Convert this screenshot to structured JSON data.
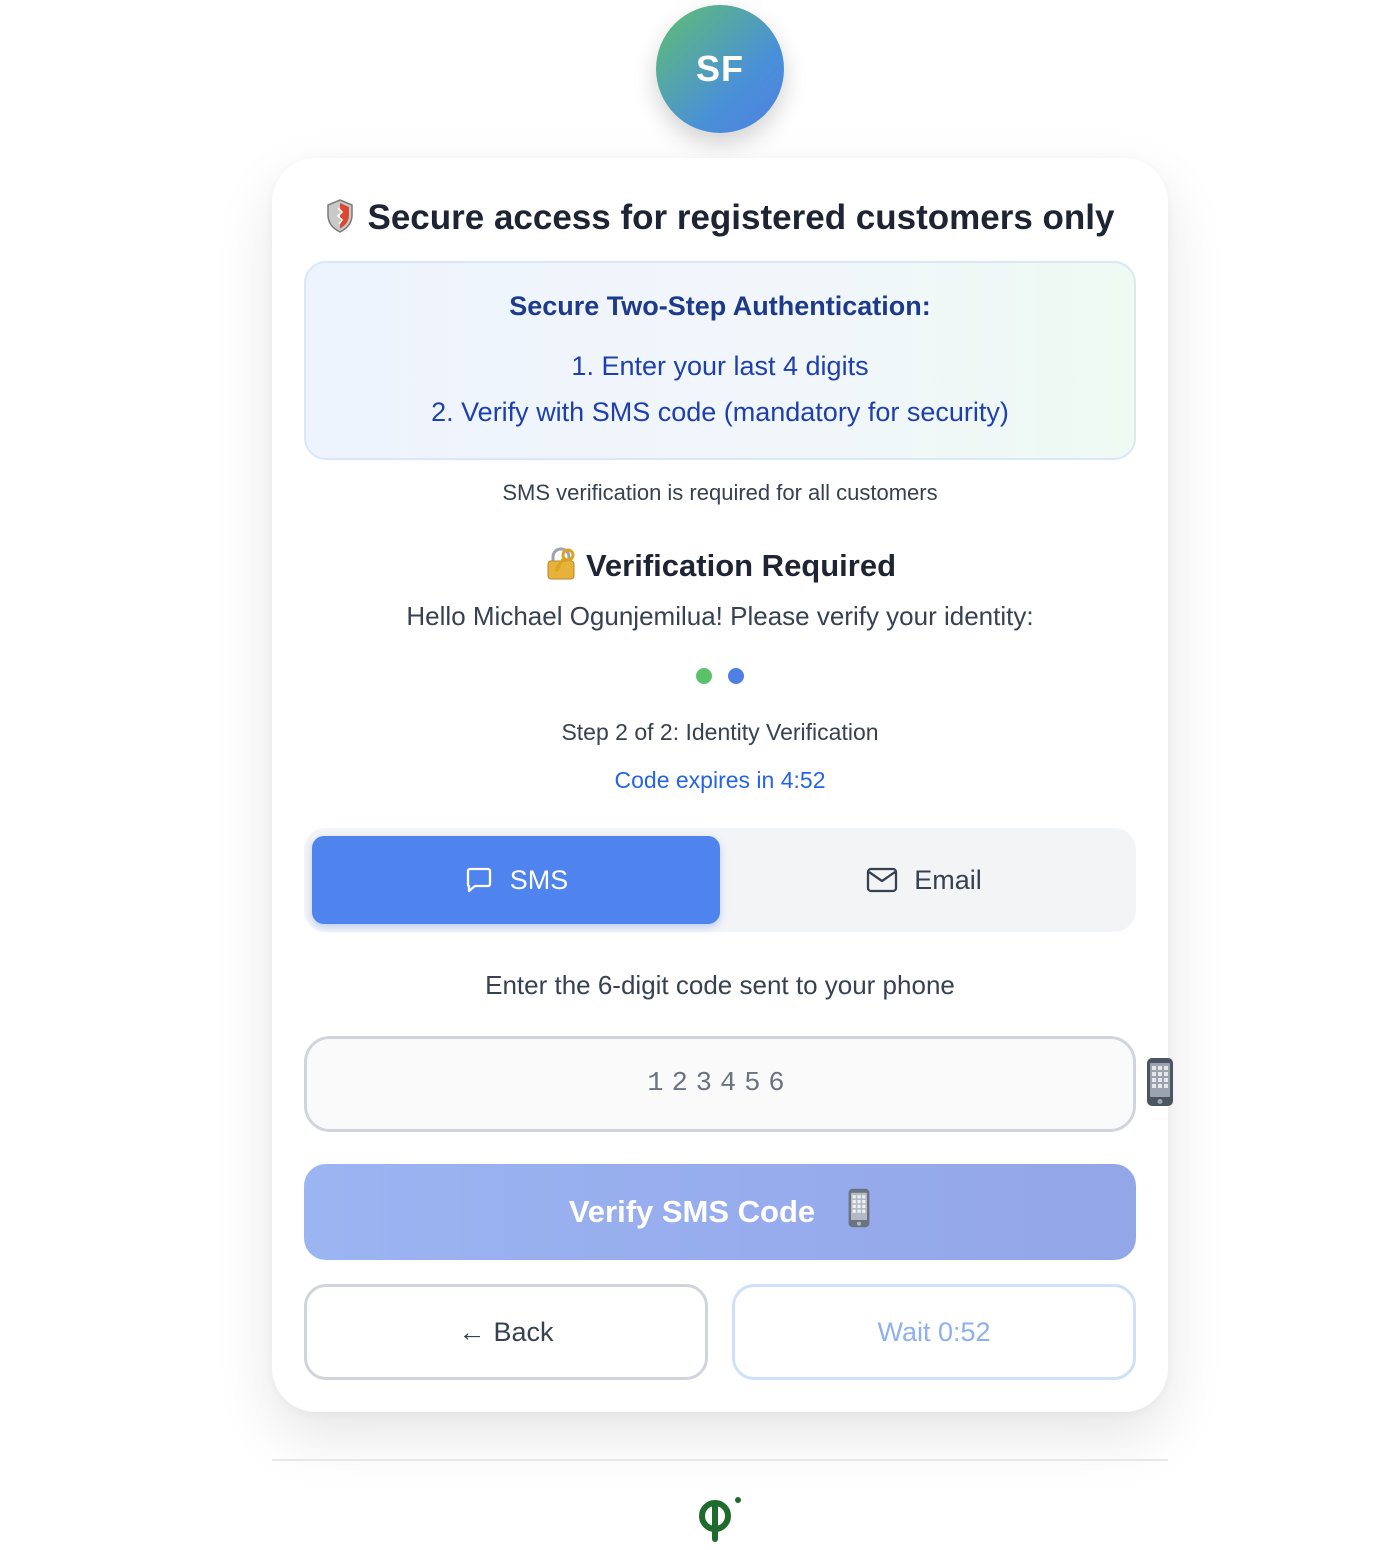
{
  "avatar": {
    "initials": "SF"
  },
  "card": {
    "title": "Secure access for registered customers only",
    "title_icon": "shield-icon",
    "info": {
      "title": "Secure Two-Step Authentication:",
      "steps": [
        "1. Enter your last 4 digits",
        "2. Verify with SMS code (mandatory for security)"
      ]
    },
    "sms_note": "SMS verification is required for all customers",
    "verification": {
      "icon": "lock-with-key-icon",
      "title": "Verification Required",
      "greeting": "Hello Michael Ogunjemilua! Please verify your identity:",
      "step_text": "Step 2 of 2: Identity Verification",
      "expires_text": "Code expires in 4:52"
    },
    "tabs": [
      {
        "label": "SMS",
        "icon": "chat-bubble-icon",
        "active": true
      },
      {
        "label": "Email",
        "icon": "mail-icon",
        "active": false
      }
    ],
    "enter_code_label": "Enter the 6-digit code sent to your phone",
    "code_input": {
      "placeholder": "123456",
      "value": ""
    },
    "verify_button": {
      "label": "Verify SMS Code",
      "icon": "mobile-phone-icon"
    },
    "back_button": {
      "arrow": "←",
      "label": "Back"
    },
    "wait_button": {
      "label": "Wait 0:52"
    }
  },
  "colors": {
    "primary": "#4f83ee",
    "step_done": "#5cc269",
    "step_current": "#4f7fe6",
    "info_text": "#1e40af"
  }
}
